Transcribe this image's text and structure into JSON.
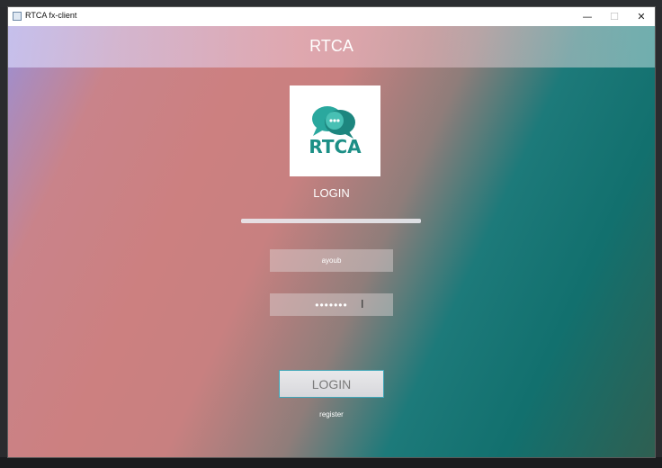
{
  "window": {
    "title": "RTCA fx-client",
    "minimize_glyph": "—",
    "maximize_glyph": "☐",
    "close_glyph": "✕"
  },
  "app": {
    "header_title": "RTCA",
    "logo_text": "RTCA",
    "logo_icon": "chat-bubbles-icon",
    "brand_color": "#1c8f86"
  },
  "login": {
    "heading": "LOGIN",
    "progress_fraction": 1.0,
    "username_value": "ayoub",
    "password_value": "•••••••",
    "login_button_label": "LOGIN",
    "register_link_label": "register"
  },
  "cursor": {
    "icon": "text-cursor-icon",
    "glyph": "I"
  },
  "colors": {
    "gradient_left": "#c9838a",
    "gradient_right": "#12706e",
    "button_border": "#3fa6b8"
  }
}
